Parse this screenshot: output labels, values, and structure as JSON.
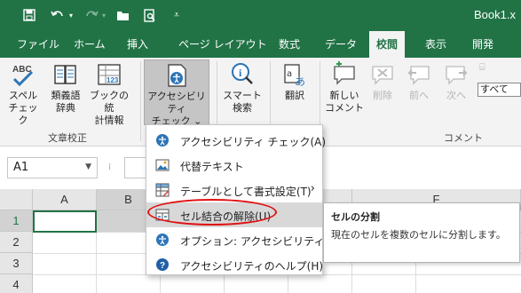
{
  "window": {
    "title": "Book1.x"
  },
  "quick_access": {
    "save_icon": "save-icon",
    "undo_icon": "undo-icon",
    "redo_icon": "redo-icon",
    "open_icon": "open-folder-icon",
    "preview_icon": "print-preview-icon",
    "customize_icon": "customize-qat-icon"
  },
  "tabs": [
    {
      "label": "ファイル"
    },
    {
      "label": "ホーム"
    },
    {
      "label": "挿入"
    },
    {
      "label": "ページ レイアウト"
    },
    {
      "label": "数式"
    },
    {
      "label": "データ"
    },
    {
      "label": "校閲",
      "active": true
    },
    {
      "label": "表示"
    },
    {
      "label": "開発"
    }
  ],
  "ribbon": {
    "spelling": {
      "line1": "スペル",
      "line2": "チェック"
    },
    "thesaurus": {
      "line1": "類義語",
      "line2": "辞典"
    },
    "workbook_stats": {
      "line1": "ブックの統",
      "line2": "計情報"
    },
    "accessibility": {
      "line1": "アクセシビリティ",
      "line2": "チェック ⌄"
    },
    "smart_lookup": {
      "line1": "スマート",
      "line2": "検索"
    },
    "translate": {
      "line1": "翻訳"
    },
    "new_comment": {
      "line1": "新しい",
      "line2": "コメント"
    },
    "delete": {
      "line1": "削除"
    },
    "previous": {
      "line1": "前へ"
    },
    "next": {
      "line1": "次へ"
    },
    "show_all": {
      "label": "すべて"
    },
    "group_proofing": "文章校正",
    "group_comments": "コメント"
  },
  "namebox": {
    "value": "A1"
  },
  "grid": {
    "columns": [
      "A",
      "B",
      "",
      "",
      "E",
      "F"
    ],
    "rows": [
      "1",
      "2",
      "3",
      "4"
    ]
  },
  "menu": {
    "items": [
      {
        "label": "アクセシビリティ チェック(A)",
        "icon": "accessibility-icon"
      },
      {
        "label": "代替テキスト",
        "icon": "alt-text-icon"
      },
      {
        "label": "テーブルとして書式設定(T)",
        "icon": "table-format-icon",
        "submenu": true
      },
      {
        "label": "セル結合の解除(U)",
        "icon": "unmerge-cells-icon"
      },
      {
        "label": "オプション: アクセシビリティ(E)",
        "icon": "accessibility-options-icon"
      },
      {
        "label": "アクセシビリティのヘルプ(H)",
        "icon": "help-icon"
      }
    ]
  },
  "tooltip": {
    "title": "セルの分割",
    "body": "現在のセルを複数のセルに分割します。"
  },
  "colors": {
    "brand": "#217346",
    "highlight_ellipse": "#e01010"
  }
}
